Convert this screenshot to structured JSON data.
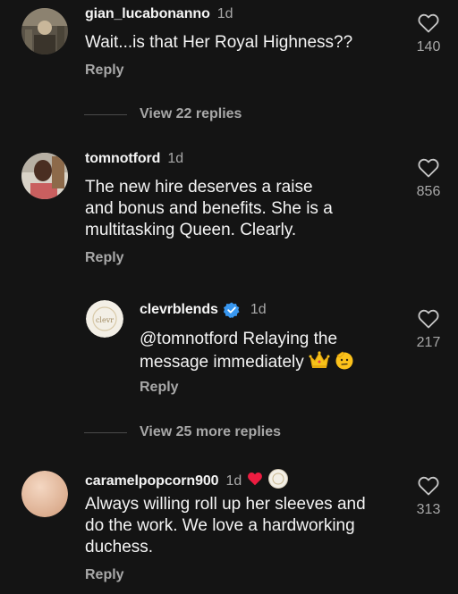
{
  "comments": [
    {
      "username": "gian_lucabonanno",
      "time": "1d",
      "text": "Wait...is that Her Royal Highness??",
      "reply_label": "Reply",
      "likes": "140",
      "avatar_icon": "photo-avatar-icon"
    },
    {
      "username": "tomnotford",
      "time": "1d",
      "text_lines": [
        "The new hire deserves a raise",
        "and bonus and benefits. She is a",
        "multitasking Queen. Clearly."
      ],
      "reply_label": "Reply",
      "likes": "856",
      "avatar_icon": "photo-avatar-icon"
    },
    {
      "username": "clevrblends",
      "verified": true,
      "time": "1d",
      "text_lines": [
        "@tomnotford Relaying the",
        "message immediately"
      ],
      "text_emojis": [
        "crown-emoji",
        "saluting-face-emoji"
      ],
      "reply_label": "Reply",
      "likes": "217",
      "avatar_icon": "brand-logo-icon",
      "avatar_logo_text": "clevr"
    },
    {
      "username": "caramelpopcorn900",
      "time": "1d",
      "badges": [
        "red-heart-icon",
        "creator-avatar-icon"
      ],
      "text_lines": [
        "Always willing roll up her sleeves and",
        "do the work. We love a hardworking",
        "duchess."
      ],
      "reply_label": "Reply",
      "likes": "313",
      "avatar_icon": "blank-avatar-icon"
    }
  ],
  "view_replies": [
    {
      "label": "View 22 replies"
    },
    {
      "label": "View 25 more replies"
    }
  ],
  "colors": {
    "background": "#141414",
    "primary_text": "#f4f4f4",
    "secondary_text": "#a8a8a8",
    "verified_blue": "#3897f0",
    "heart_red": "#ed1c40"
  }
}
